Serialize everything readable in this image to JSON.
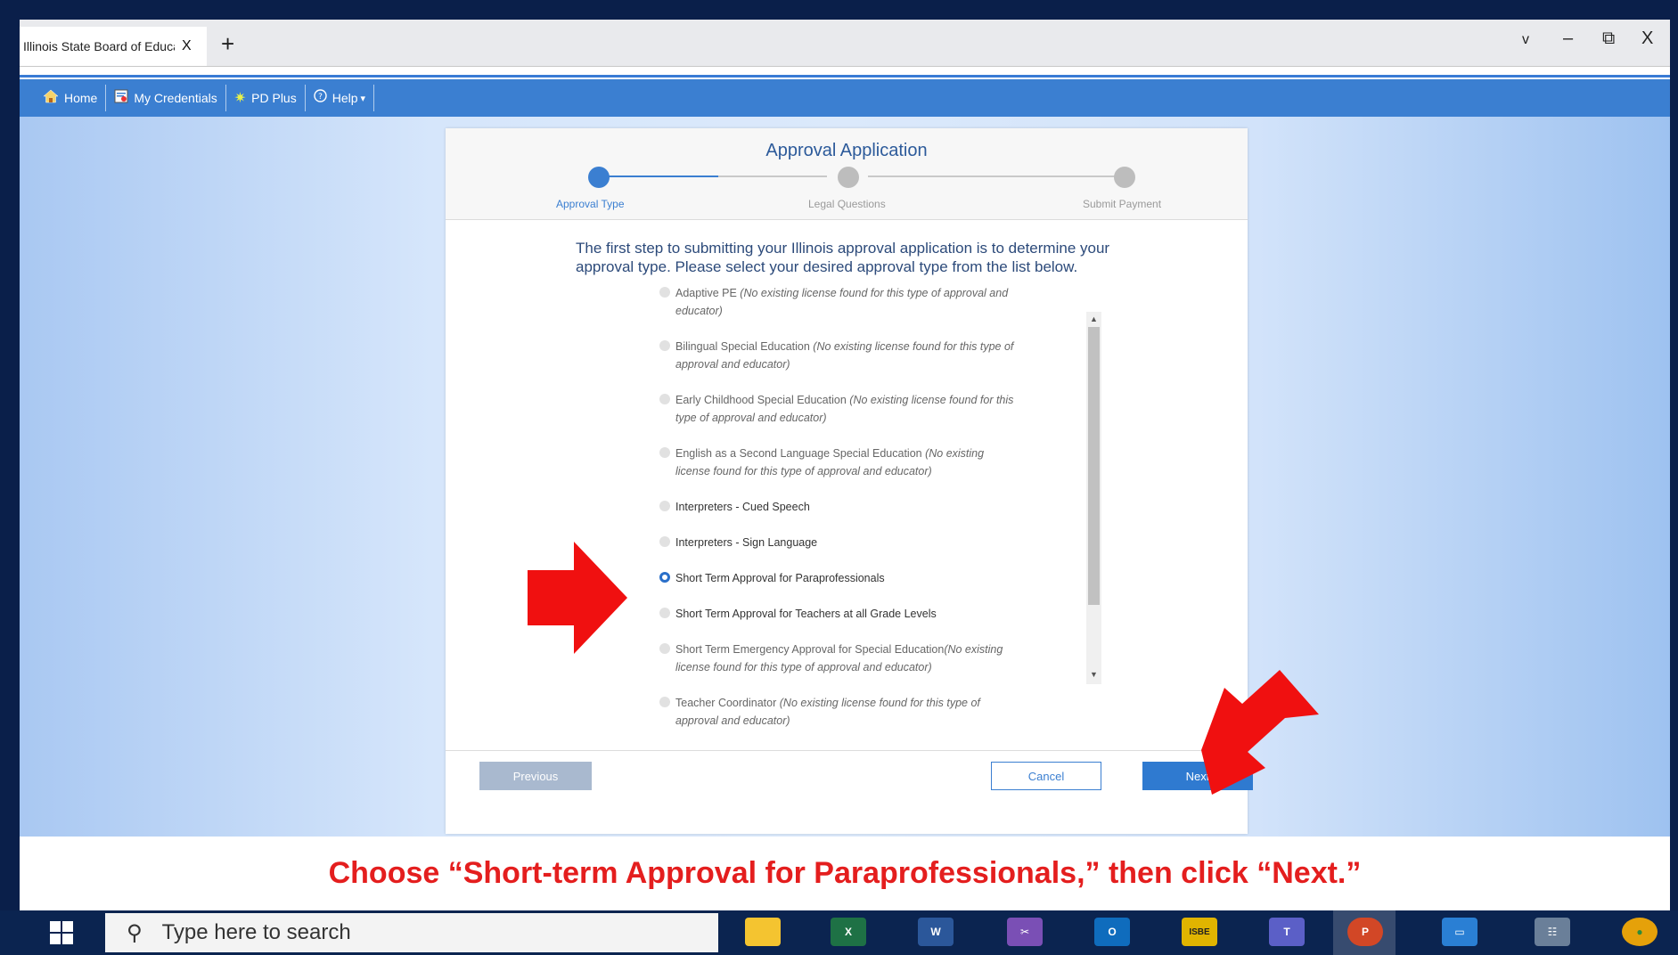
{
  "browser": {
    "tab_title": "Illinois State Board of Education",
    "tab_close": "X",
    "new_tab": "+",
    "window_controls": {
      "chevron": "v",
      "minimize": "–",
      "restore": "⧉",
      "close": "X"
    }
  },
  "nav": {
    "items": [
      {
        "label": "Home",
        "icon": "home-icon"
      },
      {
        "label": "My Credentials",
        "icon": "credentials-icon"
      },
      {
        "label": "PD Plus",
        "icon": "pd-plus-icon"
      },
      {
        "label": "Help",
        "icon": "help-icon",
        "suffix": "▾"
      }
    ]
  },
  "card": {
    "title": "Approval Application",
    "steps": [
      {
        "label": "Approval Type",
        "active": true
      },
      {
        "label": "Legal Questions",
        "active": false
      },
      {
        "label": "Submit Payment",
        "active": false
      }
    ],
    "intro": "The first step to submitting your Illinois approval application is to determine your approval type. Please select your desired approval type from the list below.",
    "options": [
      {
        "label": "Adaptive PE",
        "note": "(No existing license found for this type of approval and educator)",
        "enabled": false,
        "selected": false
      },
      {
        "label": "Bilingual Special Education",
        "note": "(No existing license found for this type of approval and educator)",
        "enabled": false,
        "selected": false
      },
      {
        "label": "Early Childhood Special Education",
        "note": "(No existing license found for this type of approval and educator)",
        "enabled": false,
        "selected": false
      },
      {
        "label": "English as a Second Language Special Education",
        "note": "(No existing license found for this type of approval and educator)",
        "enabled": false,
        "selected": false
      },
      {
        "label": "Interpreters - Cued Speech",
        "note": "",
        "enabled": true,
        "selected": false
      },
      {
        "label": "Interpreters - Sign Language",
        "note": "",
        "enabled": true,
        "selected": false
      },
      {
        "label": "Short Term Approval for Paraprofessionals",
        "note": "",
        "enabled": true,
        "selected": true
      },
      {
        "label": "Short Term Approval for Teachers at all Grade Levels",
        "note": "",
        "enabled": true,
        "selected": false
      },
      {
        "label": "Short Term Emergency Approval for Special Education",
        "note": "(No existing license found for this type of approval and educator)",
        "enabled": false,
        "selected": false
      },
      {
        "label": "Teacher Coordinator",
        "note": "(No existing license found for this type of approval and educator)",
        "enabled": false,
        "selected": false
      }
    ],
    "buttons": {
      "previous": "Previous",
      "cancel": "Cancel",
      "next": "Next"
    }
  },
  "caption": "Choose “Short-term Approval for Paraprofessionals,” then click “Next.”",
  "taskbar": {
    "search_placeholder": "Type here to search",
    "apps": [
      {
        "name": "file-explorer-icon",
        "glyph": "",
        "color": "#f4c430"
      },
      {
        "name": "excel-icon",
        "glyph": "X",
        "color": "#1e7145"
      },
      {
        "name": "word-icon",
        "glyph": "W",
        "color": "#2b579a"
      },
      {
        "name": "snipping-tool-icon",
        "glyph": "✂",
        "color": "#7a4fb5"
      },
      {
        "name": "outlook-icon",
        "glyph": "O",
        "color": "#0f6cbd"
      },
      {
        "name": "isbe-icon",
        "glyph": "ISBE",
        "color": "#e0b400"
      },
      {
        "name": "teams-icon",
        "glyph": "T",
        "color": "#5b5fc7"
      },
      {
        "name": "powerpoint-icon",
        "glyph": "P",
        "color": "#d24726"
      },
      {
        "name": "remote-desktop-icon",
        "glyph": "▭",
        "color": "#2a7fd4"
      },
      {
        "name": "calculator-icon",
        "glyph": "☷",
        "color": "#6a7f99"
      },
      {
        "name": "chrome-icon",
        "glyph": "●",
        "color": "#e5a10a"
      }
    ]
  }
}
